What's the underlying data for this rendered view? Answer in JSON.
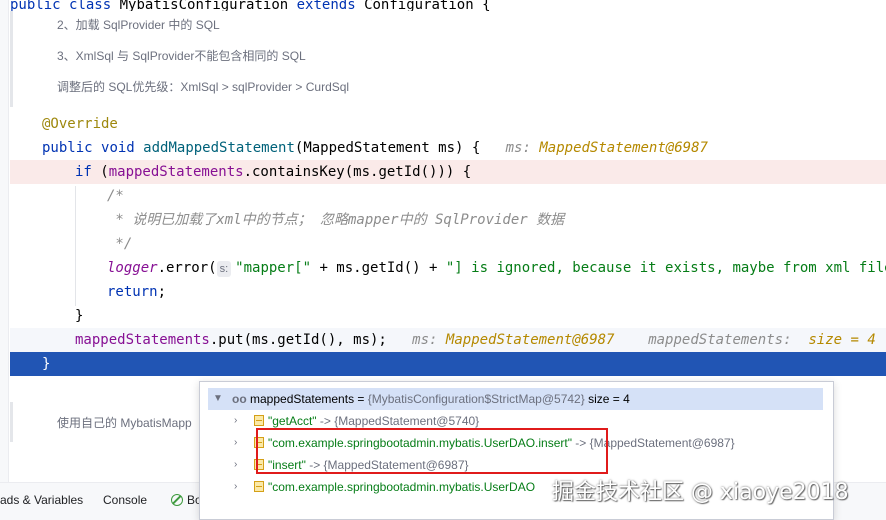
{
  "code": {
    "class_decl": {
      "kw1": "public",
      "kw2": "class",
      "name": "MybatisConfiguration",
      "kw3": "extends",
      "parent": "Configuration",
      "brace": "{"
    },
    "doc_lines": [
      "2、加载 SqlProvider 中的 SQL",
      "3、XmlSql 与 SqlProvider不能包含相同的 SQL",
      "调整后的 SQL优先级：XmlSql > sqlProvider > CurdSql"
    ],
    "annotation": "@Override",
    "method_sig": {
      "kw1": "public",
      "kw2": "void",
      "name": "addMappedStatement",
      "params": "(MappedStatement ms) {",
      "hint_label": "ms:",
      "hint_value": "MappedStatement@6987"
    },
    "if_line": {
      "kw": "if",
      "open": " (",
      "field": "mappedStatements",
      "rest": ".containsKey(ms.getId())) {"
    },
    "comment": [
      "/*",
      " * 说明已加载了xml中的节点； 忽略mapper中的 SqlProvider 数据",
      " */"
    ],
    "logger_line": {
      "field": "logger",
      "call": ".error(",
      "param_hint": "s:",
      "str1": "\"mapper[\"",
      "mid": " + ms.getId() + ",
      "str2": "\"] is ignored, because it exists, maybe from xml file\"",
      "end": ");"
    },
    "return_line": {
      "kw": "return",
      "end": ";"
    },
    "close_brace": "}",
    "put_line": {
      "field": "mappedStatements",
      "rest": ".put(ms.getId(), ms);",
      "hint1_label": "ms:",
      "hint1_value": "MappedStatement@6987",
      "hint2_label": "mappedStatements:",
      "hint2_value": "size = 4"
    },
    "final_brace": "}",
    "doc_bottom": "使用自己的 MybatisMapp"
  },
  "debug_popup": {
    "root": {
      "name": "mappedStatements",
      "eq": " = ",
      "value": "{MybatisConfiguration$StrictMap@5742}",
      "size": "size = 4"
    },
    "entries": [
      {
        "key": "\"getAcct\"",
        "arrow": " -> ",
        "value": "{MappedStatement@5740}"
      },
      {
        "key": "\"com.example.springbootadmin.mybatis.UserDAO.insert\"",
        "arrow": " -> ",
        "value": "{MappedStatement@6987}"
      },
      {
        "key": "\"insert\"",
        "arrow": " -> ",
        "value": "{MappedStatement@6987}"
      },
      {
        "key": "\"com.example.springbootadmin.mybatis.UserDAO",
        "arrow": "",
        "value": ""
      }
    ]
  },
  "bottom_tabs": [
    "ads & Variables",
    "Console",
    "Bo"
  ],
  "watermark": "掘金技术社区 @ xiaoye2018"
}
